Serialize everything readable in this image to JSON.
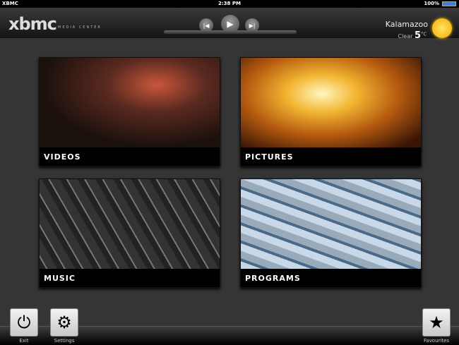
{
  "status": {
    "app": "XBMC",
    "time": "2:38 PM",
    "battery": "100%"
  },
  "header": {
    "logo": "xbmc",
    "logo_sub": "MEDIA CENTER",
    "city": "Kalamazoo",
    "condition": "Clear",
    "temp": "5",
    "unit": "°C"
  },
  "tiles": [
    {
      "label": "VIDEOS"
    },
    {
      "label": "PICTURES"
    },
    {
      "label": "MUSIC"
    },
    {
      "label": "PROGRAMS"
    }
  ],
  "footer": {
    "exit": "Exit",
    "settings": "Settings",
    "favourites": "Favourites"
  }
}
